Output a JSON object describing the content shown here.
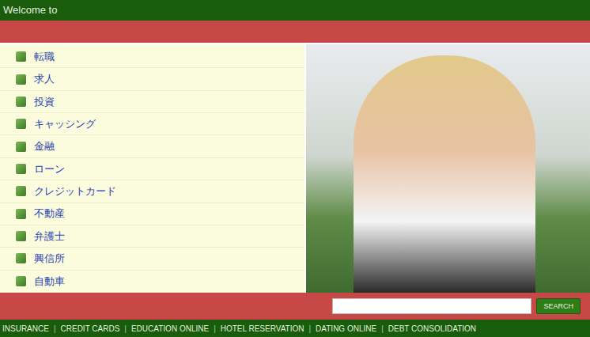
{
  "header": {
    "title": "Welcome to"
  },
  "sidebar": {
    "items": [
      {
        "label": "転職"
      },
      {
        "label": "求人"
      },
      {
        "label": "投資"
      },
      {
        "label": "キャッシング"
      },
      {
        "label": "金融"
      },
      {
        "label": "ローン"
      },
      {
        "label": "クレジットカード"
      },
      {
        "label": "不動産"
      },
      {
        "label": "弁護士"
      },
      {
        "label": "興信所"
      },
      {
        "label": "自動車"
      }
    ]
  },
  "search": {
    "button": "SEARCH"
  },
  "footer": {
    "separator": "|",
    "links": [
      "INSURANCE",
      "CREDIT CARDS",
      "EDUCATION ONLINE",
      "HOTEL RESERVATION",
      "DATING ONLINE",
      "DEBT CONSOLIDATION"
    ]
  }
}
